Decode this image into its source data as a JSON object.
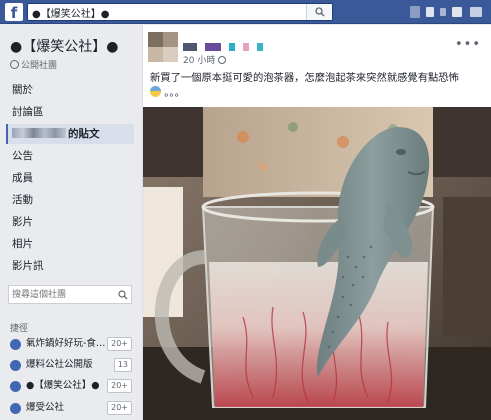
{
  "topbar": {
    "logo": "f",
    "search_value": "●【爆笑公社】●",
    "search_icon": "search-icon",
    "brand_color": "#3b5998"
  },
  "sidebar": {
    "group_name": "●【爆笑公社】●",
    "privacy_label": "公開社團",
    "nav_items": [
      {
        "label": "關於"
      },
      {
        "label": "討論區"
      },
      {
        "label": "的貼文",
        "active": true
      },
      {
        "label": "公告"
      },
      {
        "label": "成員"
      },
      {
        "label": "活動"
      },
      {
        "label": "影片"
      },
      {
        "label": "相片"
      },
      {
        "label": "影片訊"
      }
    ],
    "search_placeholder": "搜尋這個社團",
    "shortcuts_title": "捷徑",
    "shortcuts": [
      {
        "label": "氣炸鍋好好玩-食…",
        "badge": "20+"
      },
      {
        "label": "爆料公社公開版",
        "badge": "13"
      },
      {
        "label": "●【爆笑公社】●",
        "badge": "20+"
      },
      {
        "label": "爆受公社",
        "badge": "20+"
      }
    ]
  },
  "post": {
    "timestamp": "20 小時",
    "more": "•••",
    "text": "新買了一個原本挺可愛的泡茶器，怎麼泡起茶來突然就感覺有點恐怖",
    "text_suffix": "。。。",
    "emoji_icon": "fearful-face-icon",
    "image_description_icon": "manatee-tea-infuser-photo"
  }
}
